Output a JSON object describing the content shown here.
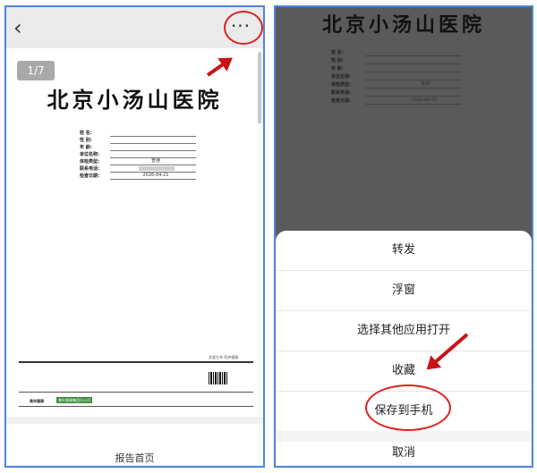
{
  "left": {
    "page_indicator": "1/7",
    "hospital_title": "北京小汤山医院",
    "form": [
      {
        "label": "姓    名:",
        "value": ""
      },
      {
        "label": "性    别:",
        "value": ""
      },
      {
        "label": "年    龄:",
        "value": ""
      },
      {
        "label": "单位名称:",
        "value": ""
      },
      {
        "label": "体检类型:",
        "value": "普通"
      },
      {
        "label": "联系电话:",
        "value": ""
      },
      {
        "label": "检查日期:",
        "value": "2026-04-21"
      }
    ],
    "footer_slogan": "关爱生命 呵护健康",
    "brand_text": "美年健康",
    "green_text": "美年健康集团分公司",
    "caption": "报告首页",
    "icons": {
      "back": "‹",
      "more": "···"
    }
  },
  "right": {
    "hospital_title": "北京小汤山医院",
    "form": [
      {
        "label": "姓    名:",
        "value": ""
      },
      {
        "label": "性    别:",
        "value": ""
      },
      {
        "label": "年    龄:",
        "value": ""
      },
      {
        "label": "单位名称:",
        "value": ""
      },
      {
        "label": "体检类型:",
        "value": "普通"
      },
      {
        "label": "联系电话:",
        "value": ""
      },
      {
        "label": "检查日期:",
        "value": "2026-04-21"
      }
    ],
    "menu": {
      "forward": "转发",
      "float_window": "浮窗",
      "open_other_app": "选择其他应用打开",
      "favorite": "收藏",
      "save_to_phone": "保存到手机",
      "cancel": "取消"
    }
  },
  "colors": {
    "annotation_red": "#c81414",
    "panel_border": "#4a86d8",
    "overlay": "#5a5a5a"
  }
}
